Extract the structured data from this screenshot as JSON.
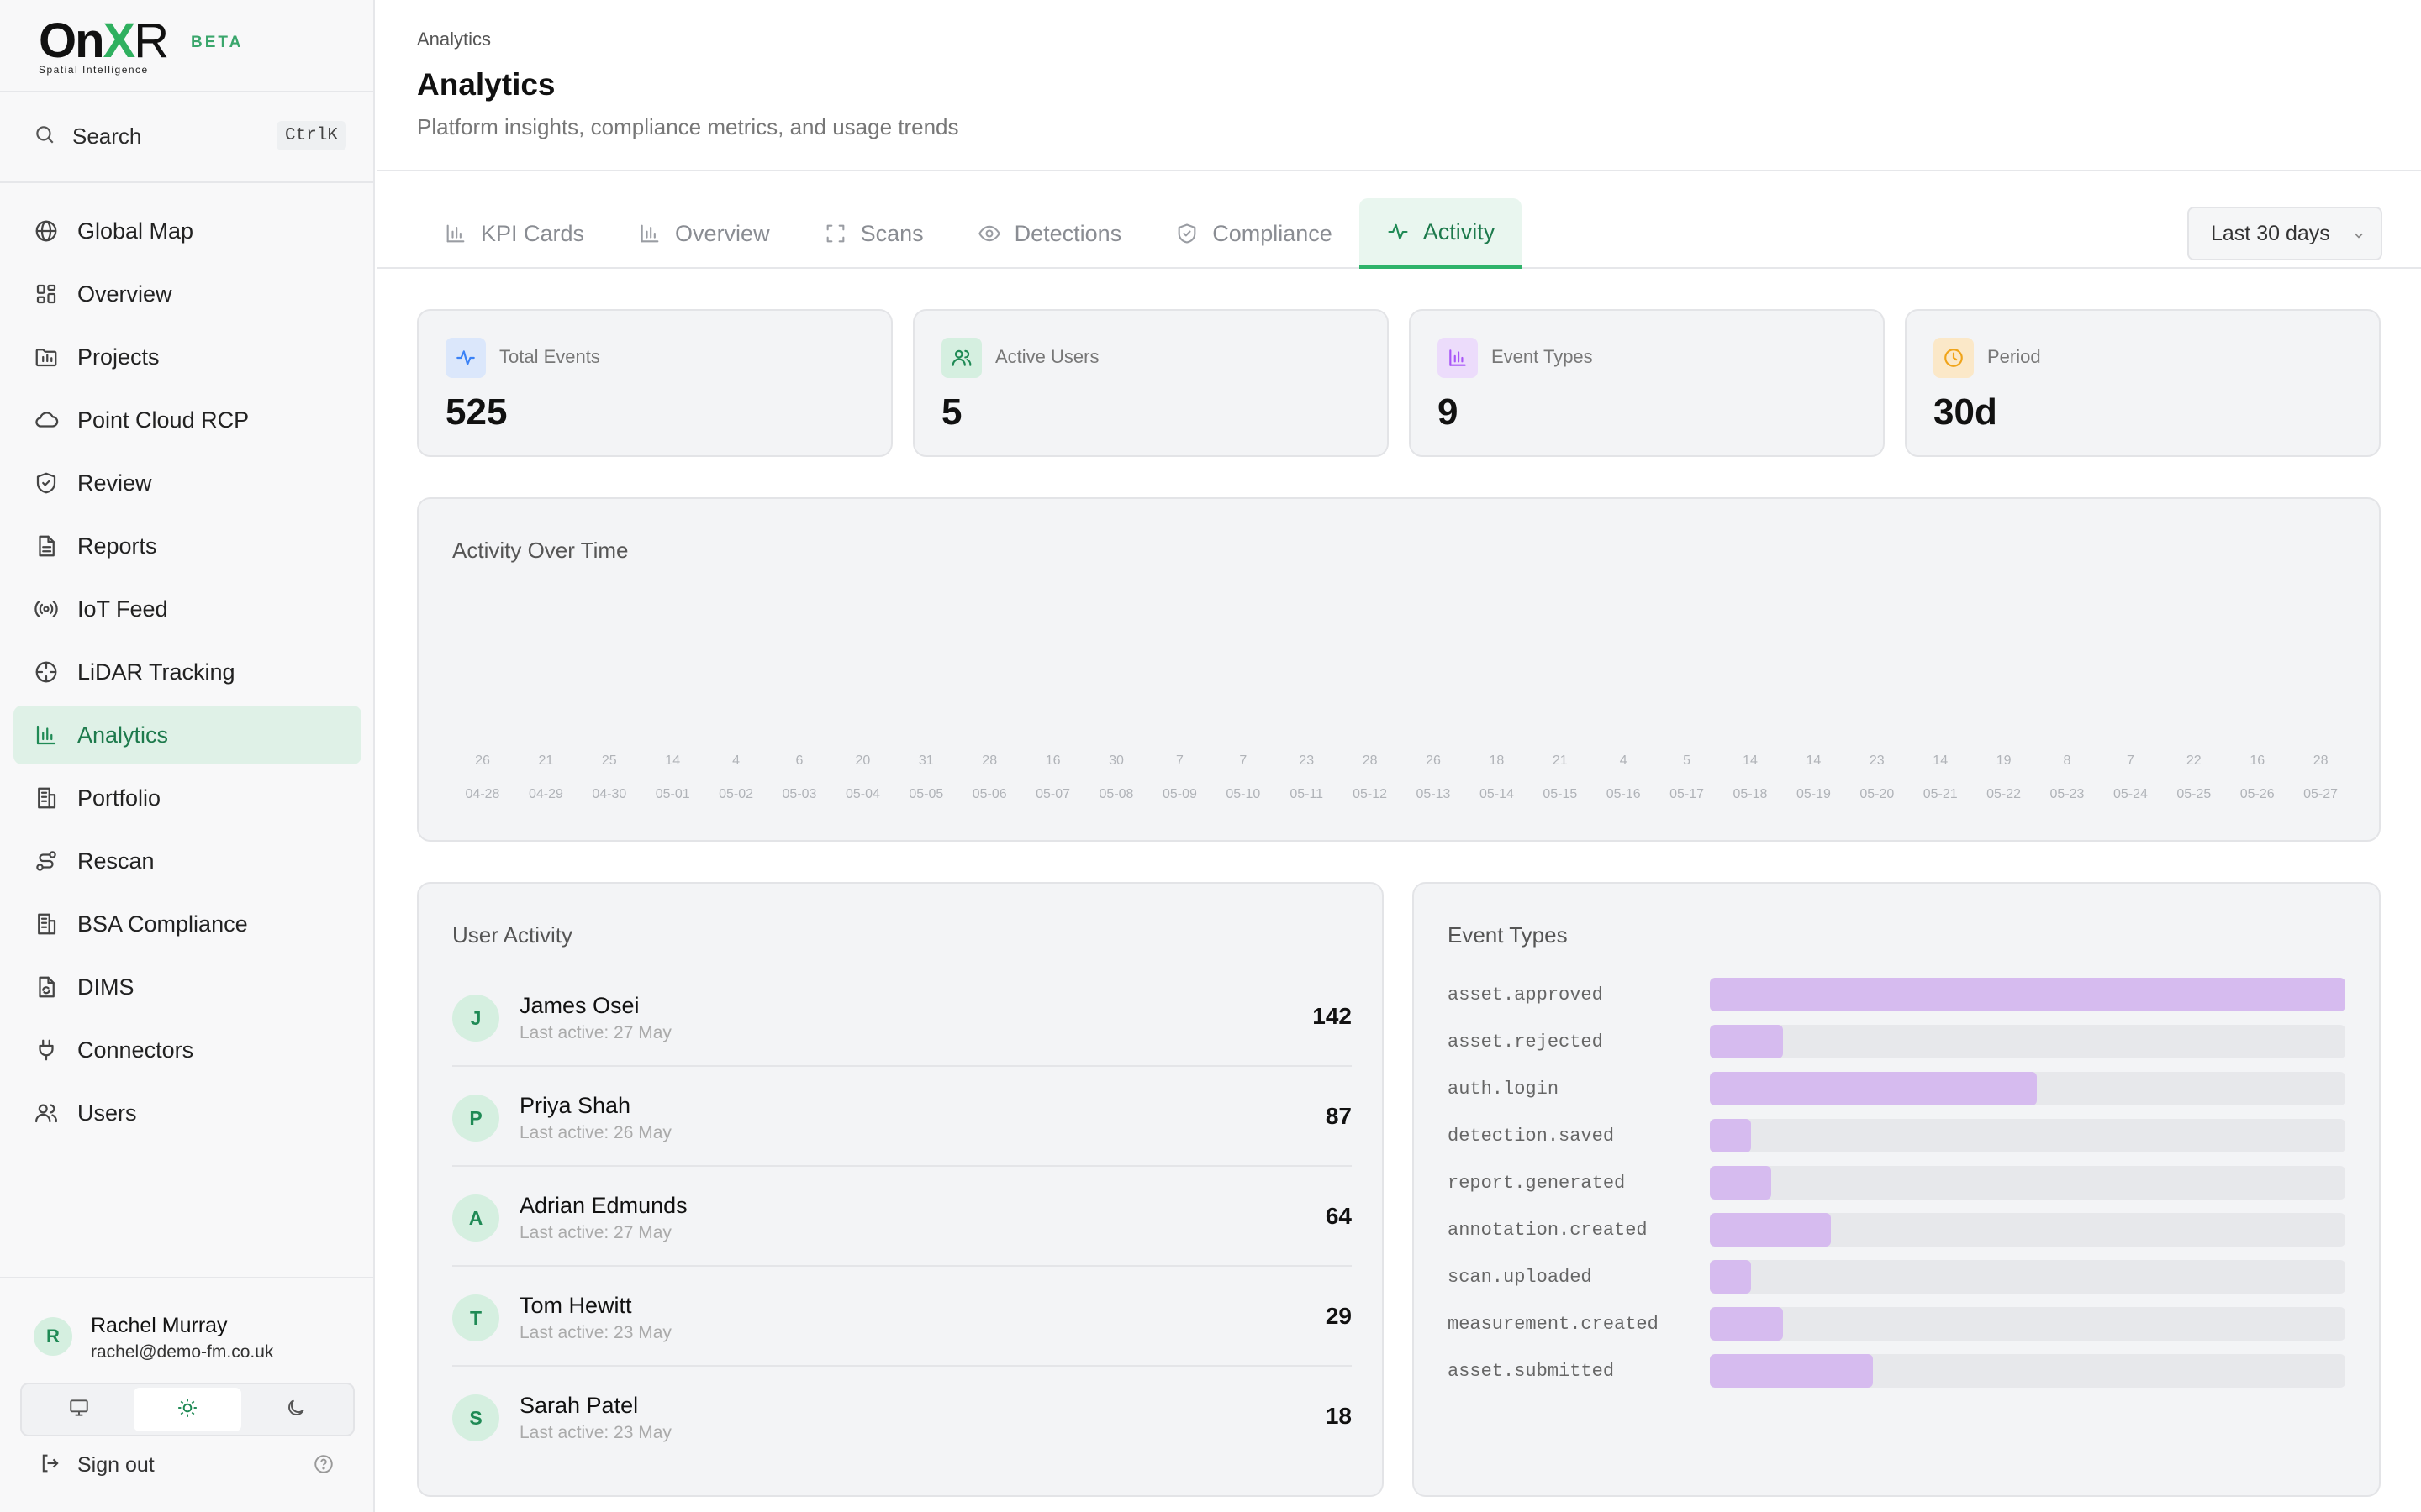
{
  "brand": {
    "name_on": "On",
    "name_x": "X",
    "name_r": "R",
    "tagline": "Spatial Intelligence",
    "badge": "BETA"
  },
  "search": {
    "label": "Search",
    "shortcut": "CtrlK"
  },
  "sidebar": {
    "items": [
      {
        "label": "Global Map",
        "icon": "globe-icon"
      },
      {
        "label": "Overview",
        "icon": "grid-icon"
      },
      {
        "label": "Projects",
        "icon": "folder-chart-icon"
      },
      {
        "label": "Point Cloud RCP",
        "icon": "cloud-icon"
      },
      {
        "label": "Review",
        "icon": "shield-check-icon"
      },
      {
        "label": "Reports",
        "icon": "document-icon"
      },
      {
        "label": "IoT Feed",
        "icon": "radio-icon"
      },
      {
        "label": "LiDAR Tracking",
        "icon": "crosshair-icon"
      },
      {
        "label": "Analytics",
        "icon": "bar-chart-icon",
        "active": true
      },
      {
        "label": "Portfolio",
        "icon": "building-icon"
      },
      {
        "label": "Rescan",
        "icon": "route-icon"
      },
      {
        "label": "BSA Compliance",
        "icon": "building-icon"
      },
      {
        "label": "DIMS",
        "icon": "file-sync-icon"
      },
      {
        "label": "Connectors",
        "icon": "plug-icon"
      },
      {
        "label": "Users",
        "icon": "users-icon"
      }
    ]
  },
  "user": {
    "initial": "R",
    "name": "Rachel Murray",
    "email": "rachel@demo-fm.co.uk",
    "signout": "Sign out"
  },
  "header": {
    "breadcrumb": "Analytics",
    "title": "Analytics",
    "subtitle": "Platform insights, compliance metrics, and usage trends"
  },
  "tabs": [
    {
      "label": "KPI Cards",
      "icon": "bar-chart-icon"
    },
    {
      "label": "Overview",
      "icon": "bar-chart-icon"
    },
    {
      "label": "Scans",
      "icon": "scan-icon"
    },
    {
      "label": "Detections",
      "icon": "eye-icon"
    },
    {
      "label": "Compliance",
      "icon": "shield-check-icon"
    },
    {
      "label": "Activity",
      "icon": "activity-icon",
      "active": true
    }
  ],
  "range": {
    "selected": "Last 30 days"
  },
  "kpis": [
    {
      "label": "Total Events",
      "value": "525",
      "icon": "activity-icon",
      "color": "#3b82f6",
      "bg": "#dbe7fb"
    },
    {
      "label": "Active Users",
      "value": "5",
      "icon": "users-icon",
      "color": "#1f8a55",
      "bg": "#d5efe0"
    },
    {
      "label": "Event Types",
      "value": "9",
      "icon": "bar-chart-icon",
      "color": "#a855f7",
      "bg": "#ecdcfb"
    },
    {
      "label": "Period",
      "value": "30d",
      "icon": "clock-icon",
      "color": "#f0a41a",
      "bg": "#fbe8c8"
    }
  ],
  "activity_chart": {
    "title": "Activity Over Time"
  },
  "chart_data": {
    "type": "bar",
    "title": "Activity Over Time",
    "categories": [
      "04-28",
      "04-29",
      "04-30",
      "05-01",
      "05-02",
      "05-03",
      "05-04",
      "05-05",
      "05-06",
      "05-07",
      "05-08",
      "05-09",
      "05-10",
      "05-11",
      "05-12",
      "05-13",
      "05-14",
      "05-15",
      "05-16",
      "05-17",
      "05-18",
      "05-19",
      "05-20",
      "05-21",
      "05-22",
      "05-23",
      "05-24",
      "05-25",
      "05-26",
      "05-27"
    ],
    "values": [
      26,
      21,
      25,
      14,
      4,
      6,
      20,
      31,
      28,
      16,
      30,
      7,
      7,
      23,
      28,
      26,
      18,
      21,
      4,
      5,
      14,
      14,
      23,
      14,
      19,
      8,
      7,
      22,
      16,
      28
    ],
    "bars_visible": false
  },
  "user_activity": {
    "title": "User Activity",
    "rows": [
      {
        "initial": "J",
        "name": "James Osei",
        "last": "Last active: 27 May",
        "count": "142"
      },
      {
        "initial": "P",
        "name": "Priya Shah",
        "last": "Last active: 26 May",
        "count": "87"
      },
      {
        "initial": "A",
        "name": "Adrian Edmunds",
        "last": "Last active: 27 May",
        "count": "64"
      },
      {
        "initial": "T",
        "name": "Tom Hewitt",
        "last": "Last active: 23 May",
        "count": "29"
      },
      {
        "initial": "S",
        "name": "Sarah Patel",
        "last": "Last active: 23 May",
        "count": "18"
      }
    ]
  },
  "event_types": {
    "title": "Event Types",
    "bar_color": "#d6bbef",
    "rows": [
      {
        "label": "asset.approved",
        "fraction": 1.0
      },
      {
        "label": "asset.rejected",
        "fraction": 0.115
      },
      {
        "label": "auth.login",
        "fraction": 0.515
      },
      {
        "label": "detection.saved",
        "fraction": 0.065
      },
      {
        "label": "report.generated",
        "fraction": 0.097
      },
      {
        "label": "annotation.created",
        "fraction": 0.19
      },
      {
        "label": "scan.uploaded",
        "fraction": 0.065
      },
      {
        "label": "measurement.created",
        "fraction": 0.115
      },
      {
        "label": "asset.submitted",
        "fraction": 0.257
      }
    ]
  }
}
